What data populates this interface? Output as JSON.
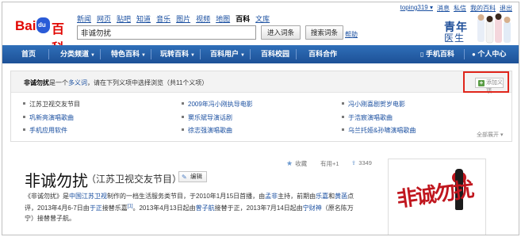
{
  "userbar": {
    "user": "toping319 ▾",
    "items": [
      "消息",
      "私信",
      "我的百科",
      "退出"
    ]
  },
  "logo": {
    "bai": "Bai",
    "du": "du",
    "baike": "百科"
  },
  "navlinks": [
    "新闻",
    "网页",
    "贴吧",
    "知道",
    "音乐",
    "图片",
    "视频",
    "地图"
  ],
  "navlinks_current": "百科",
  "navlinks_last": "文库",
  "search": {
    "value": "非诚勿扰",
    "enter_btn": "进入词条",
    "search_btn": "搜索词条",
    "help": "帮助"
  },
  "banner": {
    "line1": "青年",
    "line2": "医生"
  },
  "mainnav": {
    "items": [
      "首页",
      "分类频道",
      "特色百科",
      "玩转百科",
      "百科用户",
      "百科校园",
      "百科合作"
    ],
    "dropdown_flags": [
      false,
      true,
      true,
      true,
      true,
      false,
      false
    ],
    "right": [
      "手机百科",
      "个人中心"
    ]
  },
  "disambig": {
    "term": "非诚勿扰",
    "pre": "是一个",
    "link": "多义词",
    "post": "，请在下列义项中选择浏览（共11个义项）",
    "add": "添加义项",
    "entries": [
      {
        "label": "江苏卫视交友节目",
        "current": true
      },
      {
        "label": "2009年冯小刚执导电影",
        "current": false
      },
      {
        "label": "冯小刚喜剧贺岁电影",
        "current": false
      },
      {
        "label": "巩新亮演唱歌曲",
        "current": false
      },
      {
        "label": "窦乐斌导演话剧",
        "current": false
      },
      {
        "label": "于浩宸演唱歌曲",
        "current": false
      },
      {
        "label": "手机应用软件",
        "current": false
      },
      {
        "label": "徐志强演唱歌曲",
        "current": false
      },
      {
        "label": "乌兰托娅&孙啸演唱歌曲",
        "current": false
      }
    ],
    "expand": "全部展开 ▾"
  },
  "article": {
    "collect": "收藏",
    "useful": "有用+1",
    "share_count": "3349",
    "title": "非诚勿扰",
    "subtitle": "（江苏卫视交友节目）",
    "edit": "编辑",
    "para_parts": [
      {
        "t": "《非诚勿扰》是",
        "link": false
      },
      {
        "t": "中国江苏卫视",
        "link": true
      },
      {
        "t": "制作的一档生活服务类节目，于2010年1月15日首播，由",
        "link": false
      },
      {
        "t": "孟非",
        "link": true
      },
      {
        "t": "主持，前期由",
        "link": false
      },
      {
        "t": "乐嘉",
        "link": true
      },
      {
        "t": "和",
        "link": false
      },
      {
        "t": "黄菡",
        "link": true
      },
      {
        "t": "点评，2013年4月6-7日由",
        "link": false
      },
      {
        "t": "于正",
        "link": true
      },
      {
        "t": "接替乐嘉",
        "link": false
      },
      {
        "t": "[1]",
        "link": true,
        "sup": true
      },
      {
        "t": "。2013年4月13日起由",
        "link": false
      },
      {
        "t": "曾子航",
        "link": true
      },
      {
        "t": "接替于正，2013年7月14日起由",
        "link": false
      },
      {
        "t": "宁财神",
        "link": true
      },
      {
        "t": "（原名陈万宁）接替曾子航。",
        "link": false
      }
    ],
    "pic_text": "非诚勿扰"
  }
}
